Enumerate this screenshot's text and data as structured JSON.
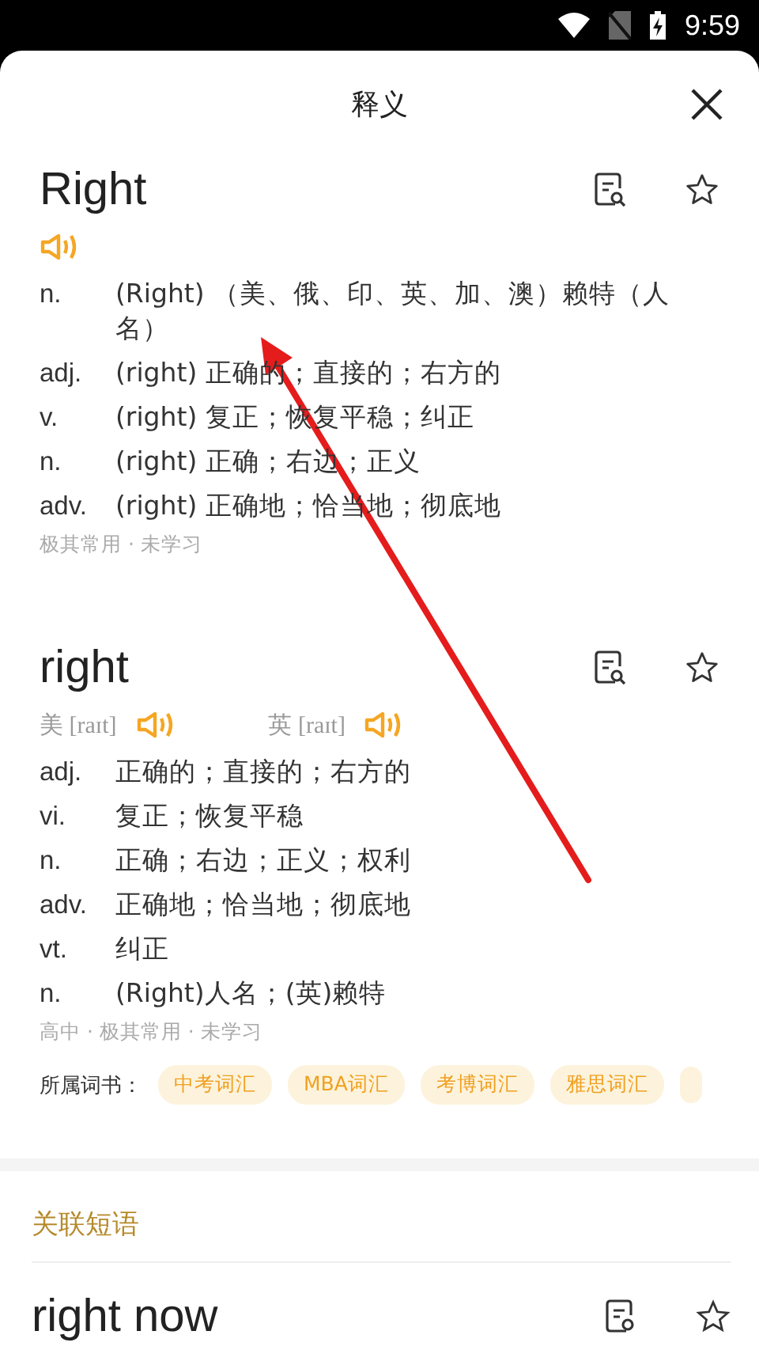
{
  "status_bar": {
    "time": "9:59"
  },
  "header": {
    "title": "释义"
  },
  "entries": [
    {
      "headword": "Right",
      "pronunciations": [
        {
          "kind": "audio"
        }
      ],
      "senses": [
        {
          "pos": "n.",
          "text": "(Right) （美、俄、印、英、加、澳）赖特（人名）"
        },
        {
          "pos": "adj.",
          "text": "(right) 正确的；直接的；右方的"
        },
        {
          "pos": "v.",
          "text": "(right) 复正；恢复平稳；纠正"
        },
        {
          "pos": "n.",
          "text": "(right) 正确；右边；正义"
        },
        {
          "pos": "adv.",
          "text": "(right) 正确地；恰当地；彻底地"
        }
      ],
      "tags": "极其常用 · 未学习"
    },
    {
      "headword": "right",
      "pronunciations": [
        {
          "kind": "labelled",
          "region": "美",
          "phonetic": "[raɪt]"
        },
        {
          "kind": "labelled",
          "region": "英",
          "phonetic": "[raɪt]"
        }
      ],
      "senses": [
        {
          "pos": "adj.",
          "text": "正确的；直接的；右方的"
        },
        {
          "pos": "vi.",
          "text": "复正；恢复平稳"
        },
        {
          "pos": "n.",
          "text": "正确；右边；正义；权利"
        },
        {
          "pos": "adv.",
          "text": "正确地；恰当地；彻底地"
        },
        {
          "pos": "vt.",
          "text": "纠正"
        },
        {
          "pos": "n.",
          "text": "(Right)人名；(英)赖特"
        }
      ],
      "tags": "高中 · 极其常用 · 未学习",
      "books": {
        "label": "所属词书：",
        "items": [
          "中考词汇",
          "MBA词汇",
          "考博词汇",
          "雅思词汇"
        ]
      }
    }
  ],
  "related": {
    "title": "关联短语",
    "items": [
      {
        "headword": "right now"
      }
    ]
  }
}
